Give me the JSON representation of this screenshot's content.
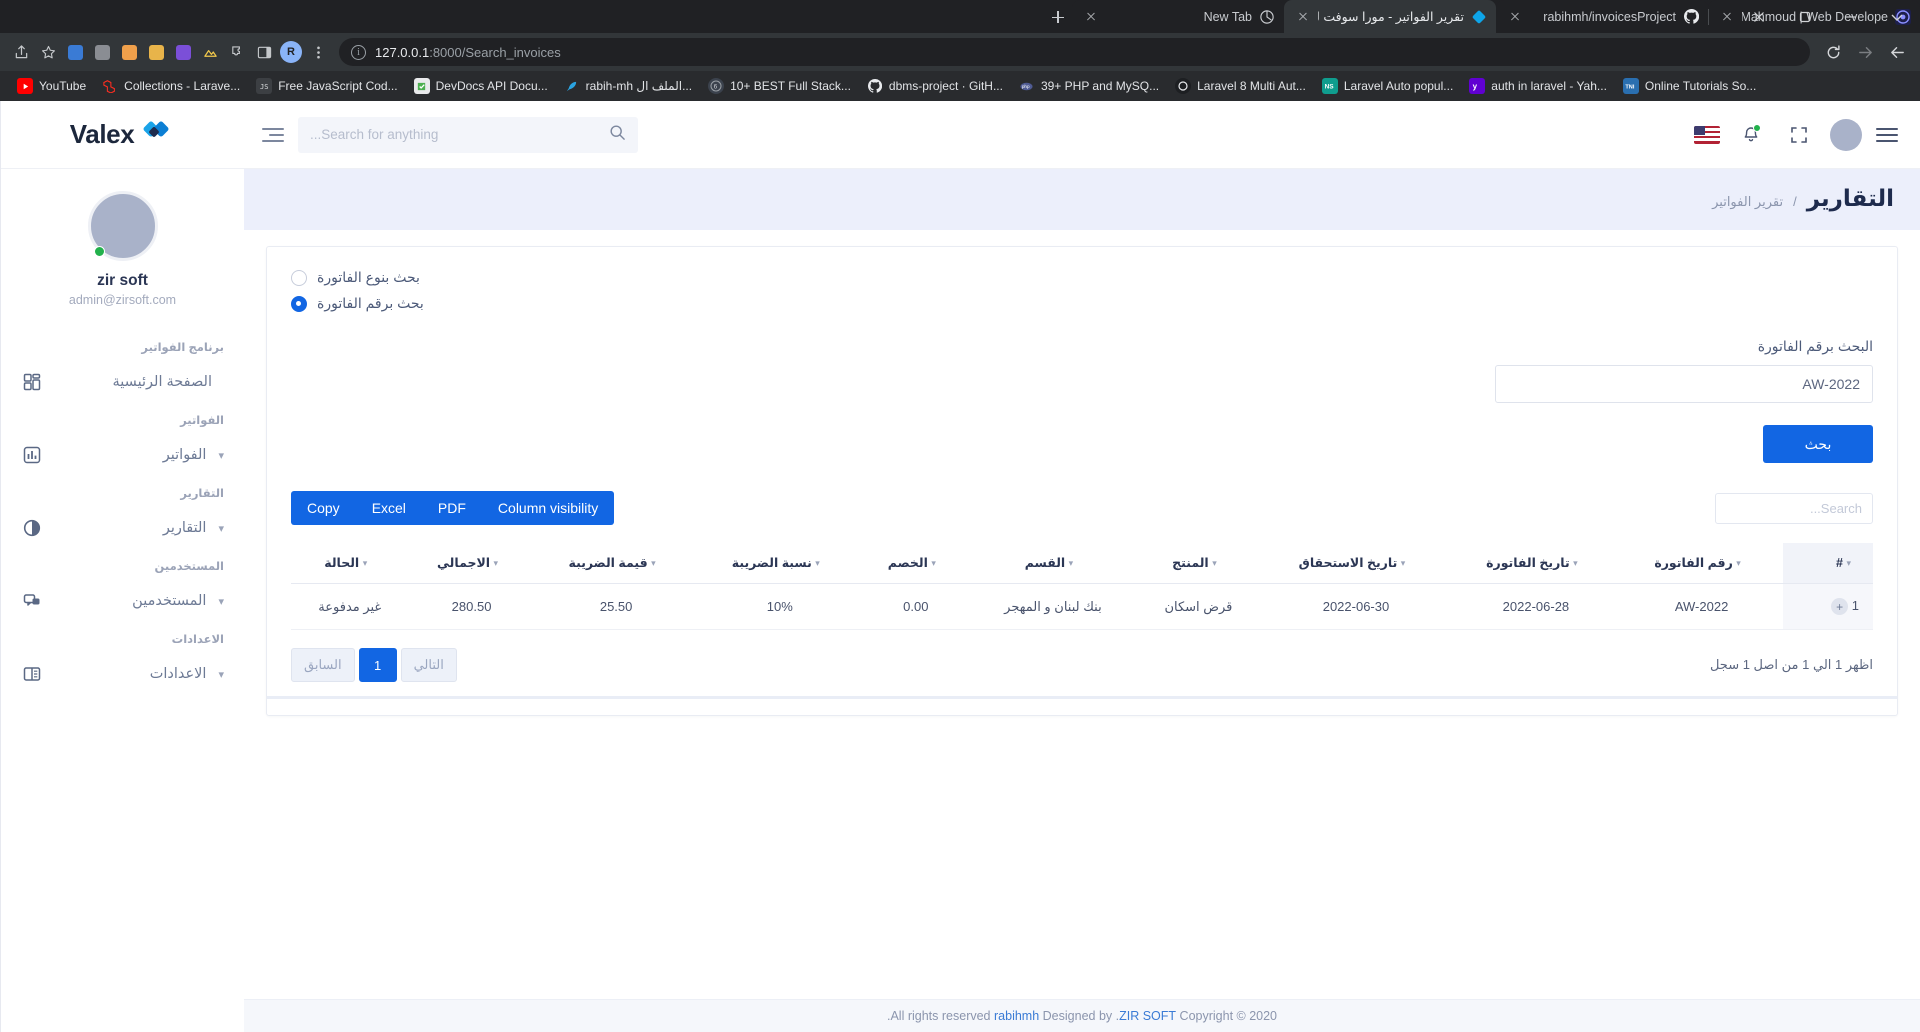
{
  "browser": {
    "tabs": [
      {
        "title": "Rabih Mahmoud | Web Develope",
        "favicon": "portfolio-icon",
        "active": false
      },
      {
        "title": "rabihmh/invoicesProject",
        "favicon": "github-icon",
        "active": false
      },
      {
        "title": "تقرير الفواتير - مورا سوفت للادارة ال",
        "favicon": "valex-icon",
        "active": true
      },
      {
        "title": "New Tab",
        "favicon": "newtab-icon",
        "active": false
      }
    ],
    "new_tab_label": "+",
    "window_controls": [
      "minimize",
      "restore",
      "close",
      "more"
    ],
    "nav": {
      "back": "←",
      "forward": "→",
      "reload": "⟳"
    },
    "url_host": "127.0.0.1",
    "url_path": ":8000/Search_invoices",
    "toolbar_icons": [
      "share-icon",
      "bookmark-star-icon",
      "extension-puzzle-icon",
      "profile-avatar"
    ],
    "profile_initial": "R",
    "bookmarks": [
      {
        "label": "YouTube",
        "icon": "youtube-icon"
      },
      {
        "label": "Collections - Larave...",
        "icon": "laravel-icon"
      },
      {
        "label": "Free JavaScript Cod...",
        "icon": "js-icon"
      },
      {
        "label": "DevDocs API Docu...",
        "icon": "devdocs-icon"
      },
      {
        "label": "rabih-mh الملف ال...",
        "icon": "feather-icon"
      },
      {
        "label": "10+ BEST Full Stack...",
        "icon": "six-icon"
      },
      {
        "label": "dbms-project · GitH...",
        "icon": "github-icon"
      },
      {
        "label": "39+ PHP and MySQ...",
        "icon": "php-icon"
      },
      {
        "label": "Laravel 8 Multi Aut...",
        "icon": "dark-circle-icon"
      },
      {
        "label": "Laravel Auto popul...",
        "icon": "ns-icon"
      },
      {
        "label": "auth in laravel - Yah...",
        "icon": "yahoo-icon"
      },
      {
        "label": "Online Tutorials So...",
        "icon": "tni-icon"
      }
    ]
  },
  "topbar": {
    "menu_icon": "hamburger-menu-icon",
    "avatar": "user-avatar",
    "fullscreen_icon": "fullscreen-icon",
    "bell_icon": "notification-bell-icon",
    "flag_icon": "us-flag-icon",
    "search_placeholder": "Search for anything...",
    "grip_icon": "settings-lines-icon"
  },
  "breadcrumb": {
    "title": "التقارير",
    "separator": "/",
    "sub": "تقرير الفواتير"
  },
  "sidebar": {
    "brand": "Valex",
    "brand_icon": "valex-diamond-logo",
    "user": {
      "name": "zir soft",
      "email": "admin@zirsoft.com",
      "status": "online"
    },
    "groups": [
      {
        "heading": "برنامج الفواتير",
        "items": [
          {
            "label": "الصفحة الرئيسية",
            "icon": "dashboard-grid-icon",
            "caret": false
          }
        ]
      },
      {
        "heading": "الفواتير",
        "items": [
          {
            "label": "الفواتير",
            "icon": "bar-chart-icon",
            "caret": true
          }
        ]
      },
      {
        "heading": "التقارير",
        "items": [
          {
            "label": "التقارير",
            "icon": "pie-chart-icon",
            "caret": true
          }
        ]
      },
      {
        "heading": "المستخدمين",
        "items": [
          {
            "label": "المستخدمين",
            "icon": "chat-users-icon",
            "caret": true
          }
        ]
      },
      {
        "heading": "الاعدادات",
        "items": [
          {
            "label": "الاعدادات",
            "icon": "book-icon",
            "caret": true
          }
        ]
      }
    ]
  },
  "form": {
    "radio_by_type": {
      "label": "بحث بنوع الفاتورة",
      "checked": false
    },
    "radio_by_number": {
      "label": "بحث برقم الفاتورة",
      "checked": true
    },
    "field_label": "البحث برقم الفاتورة",
    "field_value": "AW-2022",
    "field_placeholder": "",
    "submit_label": "بحث"
  },
  "datatable": {
    "buttons": [
      "Column visibility",
      "PDF",
      "Excel",
      "Copy"
    ],
    "search_placeholder": "Search...",
    "search_value": "",
    "columns": [
      "#",
      "رقم الفاتورة",
      "تاريخ الفاتورة",
      "تاريخ الاستحقاق",
      "المنتج",
      "القسم",
      "الخصم",
      "نسبة الضريبة",
      "قيمة الضريبة",
      "الاجمالي",
      "الحالة"
    ],
    "rows": [
      {
        "index": "1",
        "expand": "+",
        "invoice_no": "AW-2022",
        "invoice_date": "2022-06-28",
        "due_date": "2022-06-30",
        "product": "قرض اسكان",
        "department": "بنك لبنان و المهجر",
        "discount": "0.00",
        "tax_rate": "10%",
        "tax_value": "25.50",
        "total": "280.50",
        "status": "غير مدفوعة"
      }
    ],
    "pagination": {
      "prev": "السابق",
      "pages": [
        "1"
      ],
      "next": "التالي",
      "active_page": "1",
      "info": "اظهر 1 الي 1 من اصل 1 سجل"
    }
  },
  "footer": {
    "prefix": "Copyright © 2020",
    "company": "ZIR SOFT",
    "middle": ". Designed by",
    "author": "rabihmh",
    "suffix": "All rights reserved."
  },
  "colors": {
    "primary": "#1266e3",
    "link": "#3a7bd5",
    "danger": "#e4495f",
    "breadcrumb_bg": "#eceffb",
    "online": "#22b14c"
  }
}
